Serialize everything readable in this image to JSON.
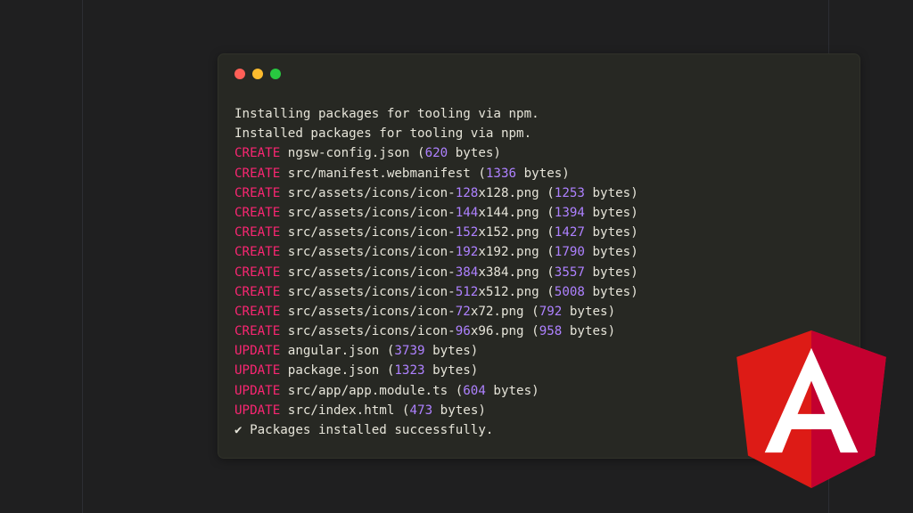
{
  "colors": {
    "background": "#1f1f20",
    "terminal_bg": "#272823",
    "text": "#e6e4d9",
    "keyword": "#f92672",
    "number": "#ae81ff",
    "angular_red": "#dd1b16",
    "angular_dark_red": "#c3002f"
  },
  "window_controls": [
    "close-light",
    "minimize-light",
    "maximize-light"
  ],
  "terminal": {
    "lines": [
      {
        "text": "Installing packages for tooling via npm."
      },
      {
        "text": "Installed packages for tooling via npm."
      },
      {
        "kw": "CREATE",
        "path": "ngsw-config.json",
        "bytes": "620"
      },
      {
        "kw": "CREATE",
        "path": "src/manifest.webmanifest",
        "bytes": "1336"
      },
      {
        "kw": "CREATE",
        "path_pre": "src/assets/icons/icon-",
        "size": "128",
        "path_post": "x128.png",
        "bytes": "1253"
      },
      {
        "kw": "CREATE",
        "path_pre": "src/assets/icons/icon-",
        "size": "144",
        "path_post": "x144.png",
        "bytes": "1394"
      },
      {
        "kw": "CREATE",
        "path_pre": "src/assets/icons/icon-",
        "size": "152",
        "path_post": "x152.png",
        "bytes": "1427"
      },
      {
        "kw": "CREATE",
        "path_pre": "src/assets/icons/icon-",
        "size": "192",
        "path_post": "x192.png",
        "bytes": "1790"
      },
      {
        "kw": "CREATE",
        "path_pre": "src/assets/icons/icon-",
        "size": "384",
        "path_post": "x384.png",
        "bytes": "3557"
      },
      {
        "kw": "CREATE",
        "path_pre": "src/assets/icons/icon-",
        "size": "512",
        "path_post": "x512.png",
        "bytes": "5008"
      },
      {
        "kw": "CREATE",
        "path_pre": "src/assets/icons/icon-",
        "size": "72",
        "path_post": "x72.png",
        "bytes": "792"
      },
      {
        "kw": "CREATE",
        "path_pre": "src/assets/icons/icon-",
        "size": "96",
        "path_post": "x96.png",
        "bytes": "958"
      },
      {
        "kw": "UPDATE",
        "path": "angular.json",
        "bytes": "3739"
      },
      {
        "kw": "UPDATE",
        "path": "package.json",
        "bytes": "1323"
      },
      {
        "kw": "UPDATE",
        "path": "src/app/app.module.ts",
        "bytes": "604"
      },
      {
        "kw": "UPDATE",
        "path": "src/index.html",
        "bytes": "473"
      },
      {
        "text": "✔ Packages installed successfully."
      }
    ],
    "bytes_suffix": " bytes)"
  },
  "logo": {
    "icon": "angular-logo-icon",
    "letter": "A"
  }
}
